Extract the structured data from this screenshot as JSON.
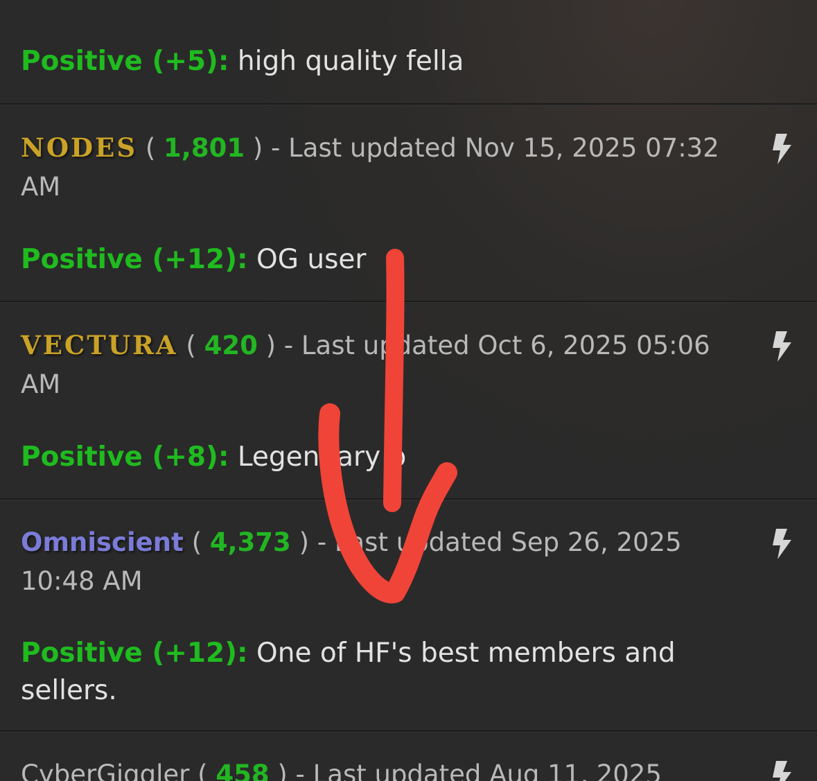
{
  "entries": [
    {
      "rating_label": "Positive (+5):",
      "comment": "high quality fella"
    },
    {
      "username": "NODES",
      "rep": "1,801",
      "updated_prefix": "- Last updated",
      "updated": "Nov 15, 2025 07:32 AM",
      "rating_label": "Positive (+12):",
      "comment": "OG user"
    },
    {
      "username": "Vectura",
      "rep": "420",
      "updated_prefix": "- Last updated",
      "updated": "Oct 6, 2025 05:06 AM",
      "rating_label": "Positive (+8):",
      "comment": "Legendary b"
    },
    {
      "username": "Omniscient",
      "rep": "4,373",
      "updated_prefix": "- Last updated",
      "updated": "Sep 26, 2025 10:48 AM",
      "rating_label": "Positive (+12):",
      "comment": "One of HF's best members and sellers."
    },
    {
      "username": "CyberGiggler",
      "rep": "458",
      "updated_prefix": "- Last updated",
      "updated": "Aug 11, 2025"
    }
  ],
  "paren_open": "(",
  "paren_close": ")",
  "icons": {
    "action": "lightning-bolt-icon",
    "annotation": "red-hand-drawn-arrow-down-icon"
  },
  "colors": {
    "positive": "#1fbb1f",
    "rep": "#22b622",
    "gold_username": "#c9a227",
    "blue_username": "#7b7bd8",
    "annotation": "#f04438"
  }
}
